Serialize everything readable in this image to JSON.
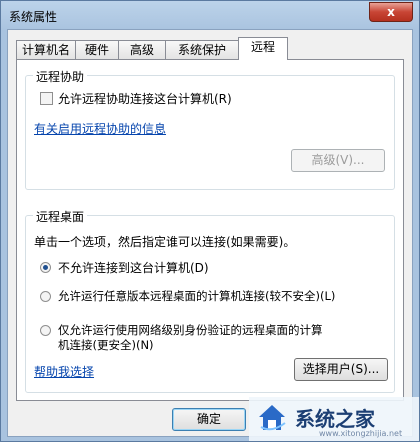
{
  "window": {
    "title": "系统属性",
    "close_glyph": "x"
  },
  "tabs": [
    {
      "label": "计算机名"
    },
    {
      "label": "硬件"
    },
    {
      "label": "高级"
    },
    {
      "label": "系统保护"
    },
    {
      "label": "远程",
      "active": true
    }
  ],
  "remote_assistance": {
    "title": "远程协助",
    "checkbox_label": "允许远程协助连接这台计算机(R)",
    "checkbox_checked": false,
    "info_link": "有关启用远程协助的信息",
    "advanced_button": "高级(V)..."
  },
  "remote_desktop": {
    "title": "远程桌面",
    "instruction": "单击一个选项，然后指定谁可以连接(如果需要)。",
    "options": [
      {
        "label": "不允许连接到这台计算机(D)",
        "checked": true
      },
      {
        "label": "允许运行任意版本远程桌面的计算机连接(较不安全)(L)",
        "checked": false
      },
      {
        "label_line1": "仅允许运行使用网络级别身份验证的远程桌面的计算",
        "label_line2": "机连接(更安全)(N)",
        "checked": false
      }
    ],
    "help_link": "帮助我选择",
    "select_users_button": "选择用户(S)..."
  },
  "footer": {
    "ok_button": "确定"
  },
  "watermark": {
    "text": "系统之家",
    "url": "www.xitongzhijia.net"
  },
  "colors": {
    "link": "#0645ad",
    "title_bar": "#a9c3df",
    "close_button": "#c84535"
  }
}
